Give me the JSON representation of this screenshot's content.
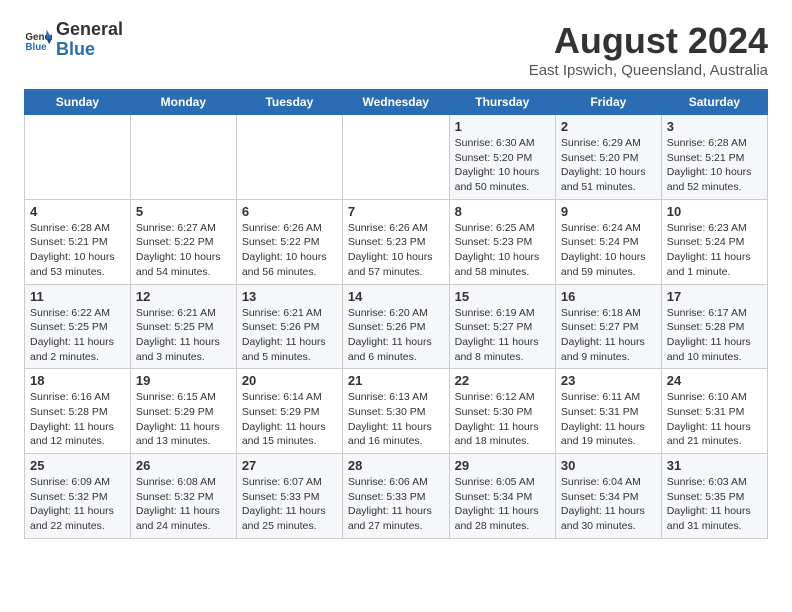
{
  "logo": {
    "text_general": "General",
    "text_blue": "Blue"
  },
  "title": "August 2024",
  "subtitle": "East Ipswich, Queensland, Australia",
  "days_of_week": [
    "Sunday",
    "Monday",
    "Tuesday",
    "Wednesday",
    "Thursday",
    "Friday",
    "Saturday"
  ],
  "weeks": [
    [
      {
        "day": "",
        "info": ""
      },
      {
        "day": "",
        "info": ""
      },
      {
        "day": "",
        "info": ""
      },
      {
        "day": "",
        "info": ""
      },
      {
        "day": "1",
        "info": "Sunrise: 6:30 AM\nSunset: 5:20 PM\nDaylight: 10 hours and 50 minutes."
      },
      {
        "day": "2",
        "info": "Sunrise: 6:29 AM\nSunset: 5:20 PM\nDaylight: 10 hours and 51 minutes."
      },
      {
        "day": "3",
        "info": "Sunrise: 6:28 AM\nSunset: 5:21 PM\nDaylight: 10 hours and 52 minutes."
      }
    ],
    [
      {
        "day": "4",
        "info": "Sunrise: 6:28 AM\nSunset: 5:21 PM\nDaylight: 10 hours and 53 minutes."
      },
      {
        "day": "5",
        "info": "Sunrise: 6:27 AM\nSunset: 5:22 PM\nDaylight: 10 hours and 54 minutes."
      },
      {
        "day": "6",
        "info": "Sunrise: 6:26 AM\nSunset: 5:22 PM\nDaylight: 10 hours and 56 minutes."
      },
      {
        "day": "7",
        "info": "Sunrise: 6:26 AM\nSunset: 5:23 PM\nDaylight: 10 hours and 57 minutes."
      },
      {
        "day": "8",
        "info": "Sunrise: 6:25 AM\nSunset: 5:23 PM\nDaylight: 10 hours and 58 minutes."
      },
      {
        "day": "9",
        "info": "Sunrise: 6:24 AM\nSunset: 5:24 PM\nDaylight: 10 hours and 59 minutes."
      },
      {
        "day": "10",
        "info": "Sunrise: 6:23 AM\nSunset: 5:24 PM\nDaylight: 11 hours and 1 minute."
      }
    ],
    [
      {
        "day": "11",
        "info": "Sunrise: 6:22 AM\nSunset: 5:25 PM\nDaylight: 11 hours and 2 minutes."
      },
      {
        "day": "12",
        "info": "Sunrise: 6:21 AM\nSunset: 5:25 PM\nDaylight: 11 hours and 3 minutes."
      },
      {
        "day": "13",
        "info": "Sunrise: 6:21 AM\nSunset: 5:26 PM\nDaylight: 11 hours and 5 minutes."
      },
      {
        "day": "14",
        "info": "Sunrise: 6:20 AM\nSunset: 5:26 PM\nDaylight: 11 hours and 6 minutes."
      },
      {
        "day": "15",
        "info": "Sunrise: 6:19 AM\nSunset: 5:27 PM\nDaylight: 11 hours and 8 minutes."
      },
      {
        "day": "16",
        "info": "Sunrise: 6:18 AM\nSunset: 5:27 PM\nDaylight: 11 hours and 9 minutes."
      },
      {
        "day": "17",
        "info": "Sunrise: 6:17 AM\nSunset: 5:28 PM\nDaylight: 11 hours and 10 minutes."
      }
    ],
    [
      {
        "day": "18",
        "info": "Sunrise: 6:16 AM\nSunset: 5:28 PM\nDaylight: 11 hours and 12 minutes."
      },
      {
        "day": "19",
        "info": "Sunrise: 6:15 AM\nSunset: 5:29 PM\nDaylight: 11 hours and 13 minutes."
      },
      {
        "day": "20",
        "info": "Sunrise: 6:14 AM\nSunset: 5:29 PM\nDaylight: 11 hours and 15 minutes."
      },
      {
        "day": "21",
        "info": "Sunrise: 6:13 AM\nSunset: 5:30 PM\nDaylight: 11 hours and 16 minutes."
      },
      {
        "day": "22",
        "info": "Sunrise: 6:12 AM\nSunset: 5:30 PM\nDaylight: 11 hours and 18 minutes."
      },
      {
        "day": "23",
        "info": "Sunrise: 6:11 AM\nSunset: 5:31 PM\nDaylight: 11 hours and 19 minutes."
      },
      {
        "day": "24",
        "info": "Sunrise: 6:10 AM\nSunset: 5:31 PM\nDaylight: 11 hours and 21 minutes."
      }
    ],
    [
      {
        "day": "25",
        "info": "Sunrise: 6:09 AM\nSunset: 5:32 PM\nDaylight: 11 hours and 22 minutes."
      },
      {
        "day": "26",
        "info": "Sunrise: 6:08 AM\nSunset: 5:32 PM\nDaylight: 11 hours and 24 minutes."
      },
      {
        "day": "27",
        "info": "Sunrise: 6:07 AM\nSunset: 5:33 PM\nDaylight: 11 hours and 25 minutes."
      },
      {
        "day": "28",
        "info": "Sunrise: 6:06 AM\nSunset: 5:33 PM\nDaylight: 11 hours and 27 minutes."
      },
      {
        "day": "29",
        "info": "Sunrise: 6:05 AM\nSunset: 5:34 PM\nDaylight: 11 hours and 28 minutes."
      },
      {
        "day": "30",
        "info": "Sunrise: 6:04 AM\nSunset: 5:34 PM\nDaylight: 11 hours and 30 minutes."
      },
      {
        "day": "31",
        "info": "Sunrise: 6:03 AM\nSunset: 5:35 PM\nDaylight: 11 hours and 31 minutes."
      }
    ]
  ]
}
